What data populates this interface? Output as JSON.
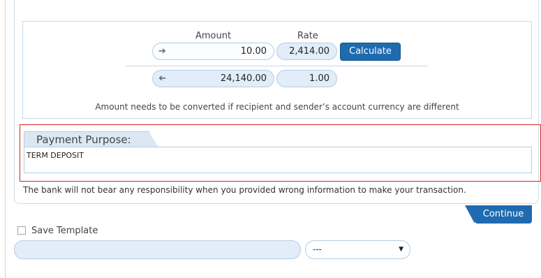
{
  "converter": {
    "amount_label": "Amount",
    "rate_label": "Rate",
    "row1": {
      "amount": "10.00",
      "rate": "2,414.00",
      "icon": "arrow-right-icon"
    },
    "row2": {
      "amount": "24,140.00",
      "rate": "1.00",
      "icon": "arrow-left-icon"
    },
    "calculate_label": "Calculate",
    "note": "Amount needs to be converted if recipient and sender’s account currency are different"
  },
  "payment_purpose": {
    "label": "Payment Purpose:",
    "value": "TERM DEPOSIT"
  },
  "disclaimer": "The bank will not bear any responsibility when you provided wrong information to make your transaction.",
  "continue_label": "Continue",
  "template": {
    "save_label": "Save Template",
    "checked": false,
    "name_value": "",
    "select_value": "---"
  },
  "colors": {
    "primary_button": "#1f6bb0",
    "input_fill": "#e1edf8",
    "highlight_border": "#d2232a"
  }
}
